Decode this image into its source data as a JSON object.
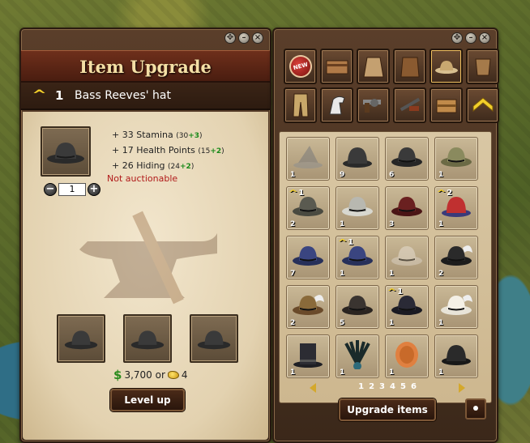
{
  "left_window": {
    "title": "Item Upgrade",
    "level": "1",
    "item_name": "Bass Reeves' hat",
    "stats": [
      {
        "text": "+ 33 Stamina",
        "detail_base": "(30",
        "detail_bonus": "+3",
        "detail_end": ")"
      },
      {
        "text": "+ 17 Health Points",
        "detail_base": "(15",
        "detail_bonus": "+2",
        "detail_end": ")"
      },
      {
        "text": "+ 26 Hiding",
        "detail_base": "(24",
        "detail_bonus": "+2",
        "detail_end": ")"
      }
    ],
    "not_actionable": "Not auctionable",
    "quantity": "1",
    "cost_money": "3,700 or",
    "cost_nuggets": "4",
    "level_up_label": "Level up",
    "minus": "−",
    "plus": "+",
    "dollar_sign": "$"
  },
  "right_window": {
    "new_badge": "NEW",
    "inventory": [
      {
        "count": "1",
        "upgrade": "",
        "hat": "wizard-grey"
      },
      {
        "count": "9",
        "upgrade": "",
        "hat": "bowler-black"
      },
      {
        "count": "6",
        "upgrade": "",
        "hat": "cowboy-black"
      },
      {
        "count": "1",
        "upgrade": "",
        "hat": "cowboy-olive"
      },
      {
        "count": "2",
        "upgrade": "1",
        "hat": "cowboy-grey"
      },
      {
        "count": "1",
        "upgrade": "",
        "hat": "cowboy-white"
      },
      {
        "count": "3",
        "upgrade": "",
        "hat": "cowboy-maroon"
      },
      {
        "count": "1",
        "upgrade": "2",
        "hat": "bowler-red"
      },
      {
        "count": "7",
        "upgrade": "",
        "hat": "cowboy-navy"
      },
      {
        "count": "1",
        "upgrade": "1",
        "hat": "cowboy-navy2"
      },
      {
        "count": "1",
        "upgrade": "",
        "hat": "cowboy-ghost"
      },
      {
        "count": "2",
        "upgrade": "",
        "hat": "feather-black"
      },
      {
        "count": "2",
        "upgrade": "",
        "hat": "feather-brown"
      },
      {
        "count": "5",
        "upgrade": "",
        "hat": "cowboy-dark"
      },
      {
        "count": "1",
        "upgrade": "1",
        "hat": "cowboy-band"
      },
      {
        "count": "1",
        "upgrade": "",
        "hat": "feather-white"
      },
      {
        "count": "1",
        "upgrade": "",
        "hat": "tophat"
      },
      {
        "count": "1",
        "upgrade": "",
        "hat": "headdress"
      },
      {
        "count": "1",
        "upgrade": "",
        "hat": "wig"
      },
      {
        "count": "1",
        "upgrade": "",
        "hat": "bowler-plain"
      }
    ],
    "pages": [
      "1",
      "2",
      "3",
      "4",
      "5",
      "6"
    ],
    "upgrade_items_label": "Upgrade items"
  },
  "colors": {
    "accent_gold": "#f2cf2a",
    "title_text": "#f4dfa5",
    "green_bonus": "#1a8a1a",
    "red_warning": "#b11a1a"
  }
}
